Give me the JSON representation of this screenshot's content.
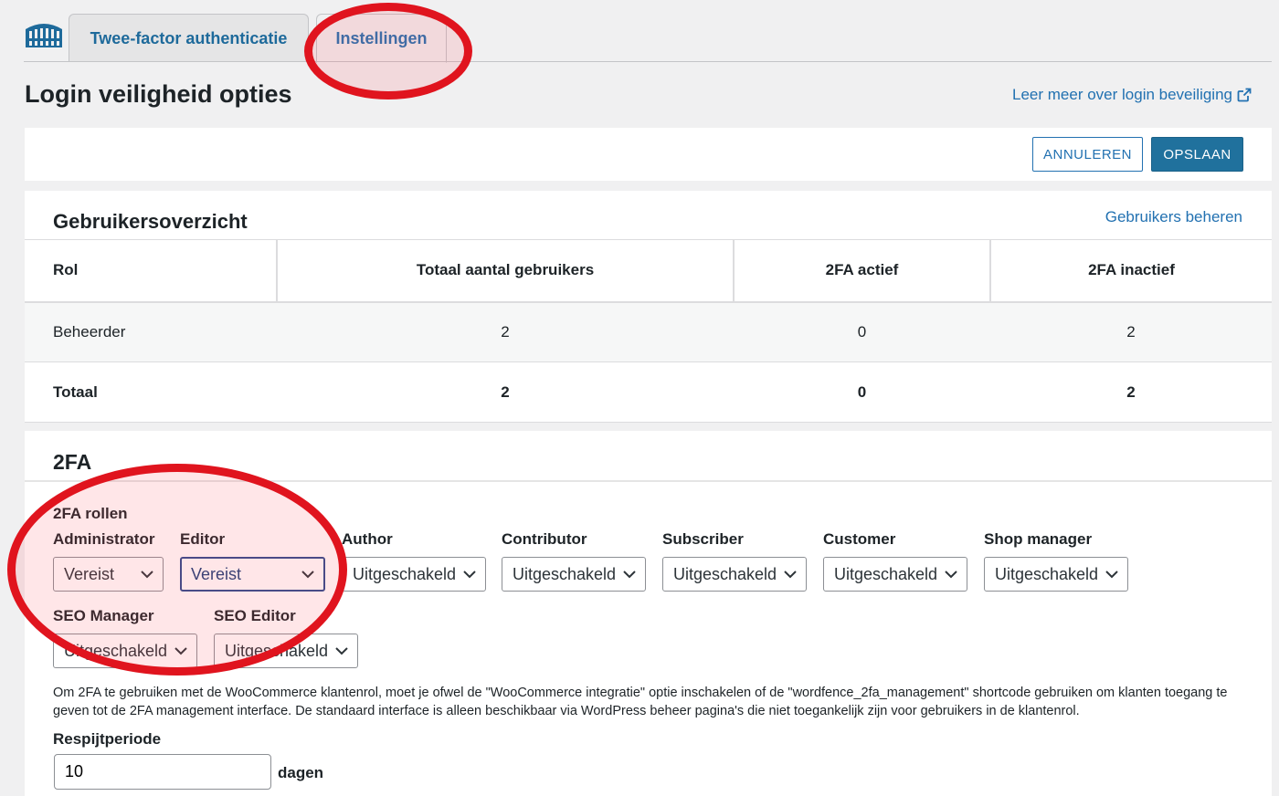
{
  "header": {
    "tabs": [
      {
        "label": "Twee-factor authenticatie"
      },
      {
        "label": "Instellingen"
      }
    ],
    "page_title": "Login veiligheid opties",
    "learn_more_link": "Leer meer over login beveiliging"
  },
  "actions": {
    "cancel_label": "ANNULEREN",
    "save_label": "OPSLAAN"
  },
  "overview": {
    "title": "Gebruikersoverzicht",
    "manage_link": "Gebruikers beheren",
    "columns": [
      "Rol",
      "Totaal aantal gebruikers",
      "2FA actief",
      "2FA inactief"
    ],
    "rows": [
      {
        "rol": "Beheerder",
        "total": "2",
        "active": "0",
        "inactive": "2"
      },
      {
        "rol": "Totaal",
        "total": "2",
        "active": "0",
        "inactive": "2"
      }
    ]
  },
  "tfa": {
    "title": "2FA",
    "roles_title": "2FA rollen",
    "roles": [
      {
        "label": "Administrator",
        "value": "Vereist"
      },
      {
        "label": "Editor",
        "value": "Vereist"
      },
      {
        "label": "Author",
        "value": "Uitgeschakeld"
      },
      {
        "label": "Contributor",
        "value": "Uitgeschakeld"
      },
      {
        "label": "Subscriber",
        "value": "Uitgeschakeld"
      },
      {
        "label": "Customer",
        "value": "Uitgeschakeld"
      },
      {
        "label": "Shop manager",
        "value": "Uitgeschakeld"
      },
      {
        "label": "SEO Manager",
        "value": "Uitgeschakeld"
      },
      {
        "label": "SEO Editor",
        "value": "Uitgeschakeld"
      }
    ],
    "note": "Om 2FA te gebruiken met de WooCommerce klantenrol, moet je ofwel de \"WooCommerce integratie\" optie inschakelen of de \"wordfence_2fa_management\" shortcode gebruiken om klanten toegang te geven tot de 2FA management interface. De standaard interface is alleen beschikbaar via WordPress beheer pagina's die niet toegankelijk zijn voor gebruikers in de klantenrol.",
    "grace_title": "Respijtperiode",
    "grace_value": "10",
    "grace_unit": "dagen"
  },
  "icons": {
    "logo": "wordfence-logo-icon",
    "external_link": "external-link-icon",
    "dropdown": "chevron-down-icon"
  },
  "colors": {
    "accent": "#2271b1",
    "primary_button": "#20719d",
    "annotation": "#e0141e"
  }
}
